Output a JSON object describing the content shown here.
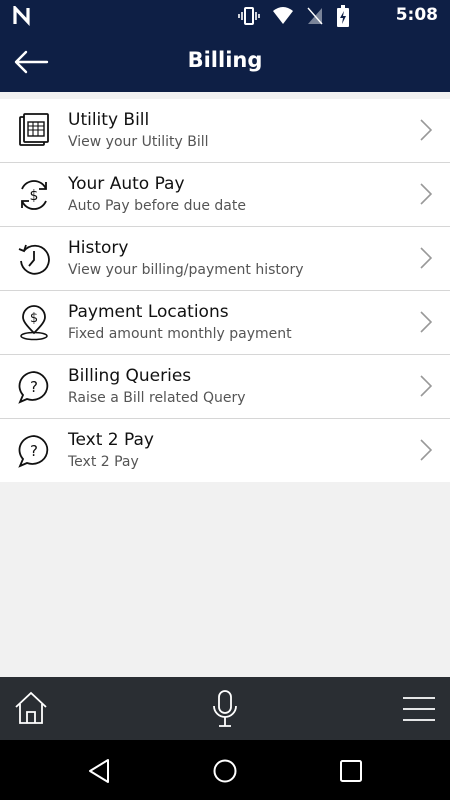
{
  "status_bar": {
    "time": "5:08"
  },
  "app_bar": {
    "title": "Billing"
  },
  "menu": [
    {
      "icon": "bill-icon",
      "title": "Utility Bill",
      "subtitle": "View your Utility Bill"
    },
    {
      "icon": "autopay-icon",
      "title": "Your Auto Pay",
      "subtitle": "Auto Pay before due date"
    },
    {
      "icon": "history-icon",
      "title": "History",
      "subtitle": "View your billing/payment history"
    },
    {
      "icon": "location-icon",
      "title": "Payment Locations",
      "subtitle": "Fixed amount monthly payment"
    },
    {
      "icon": "query-icon",
      "title": "Billing Queries",
      "subtitle": "Raise a Bill related Query"
    },
    {
      "icon": "query-icon",
      "title": "Text 2 Pay",
      "subtitle": "Text 2 Pay"
    }
  ],
  "colors": {
    "header": "#0e1f45",
    "bottom_bar": "#2a2e33",
    "background": "#f1f1f1"
  }
}
